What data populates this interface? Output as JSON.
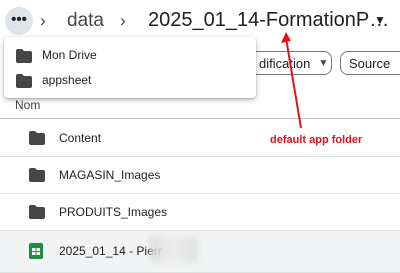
{
  "breadcrumb": {
    "more_label": "•••",
    "items": [
      "data"
    ],
    "current": "2025_01_14-FormationP…"
  },
  "toolbar": {
    "filters": [
      {
        "label": "dification"
      },
      {
        "label": "Source"
      }
    ]
  },
  "dropdown": {
    "items": [
      {
        "label": "Mon Drive",
        "icon": "folder-icon"
      },
      {
        "label": "appsheet",
        "icon": "folder-icon"
      }
    ]
  },
  "list": {
    "column_header": "Nom",
    "rows": [
      {
        "label": "Content",
        "icon": "folder-icon"
      },
      {
        "label": "MAGASIN_Images",
        "icon": "folder-icon"
      },
      {
        "label": "PRODUITS_Images",
        "icon": "folder-icon"
      },
      {
        "label": "2025_01_14 - Pierr",
        "icon": "google-sheets-icon"
      }
    ]
  },
  "annotation": {
    "text": "default app folder",
    "color": "#e0131c"
  },
  "colors": {
    "sheets_green": "#1e8e3e",
    "folder_gray": "#444746"
  }
}
